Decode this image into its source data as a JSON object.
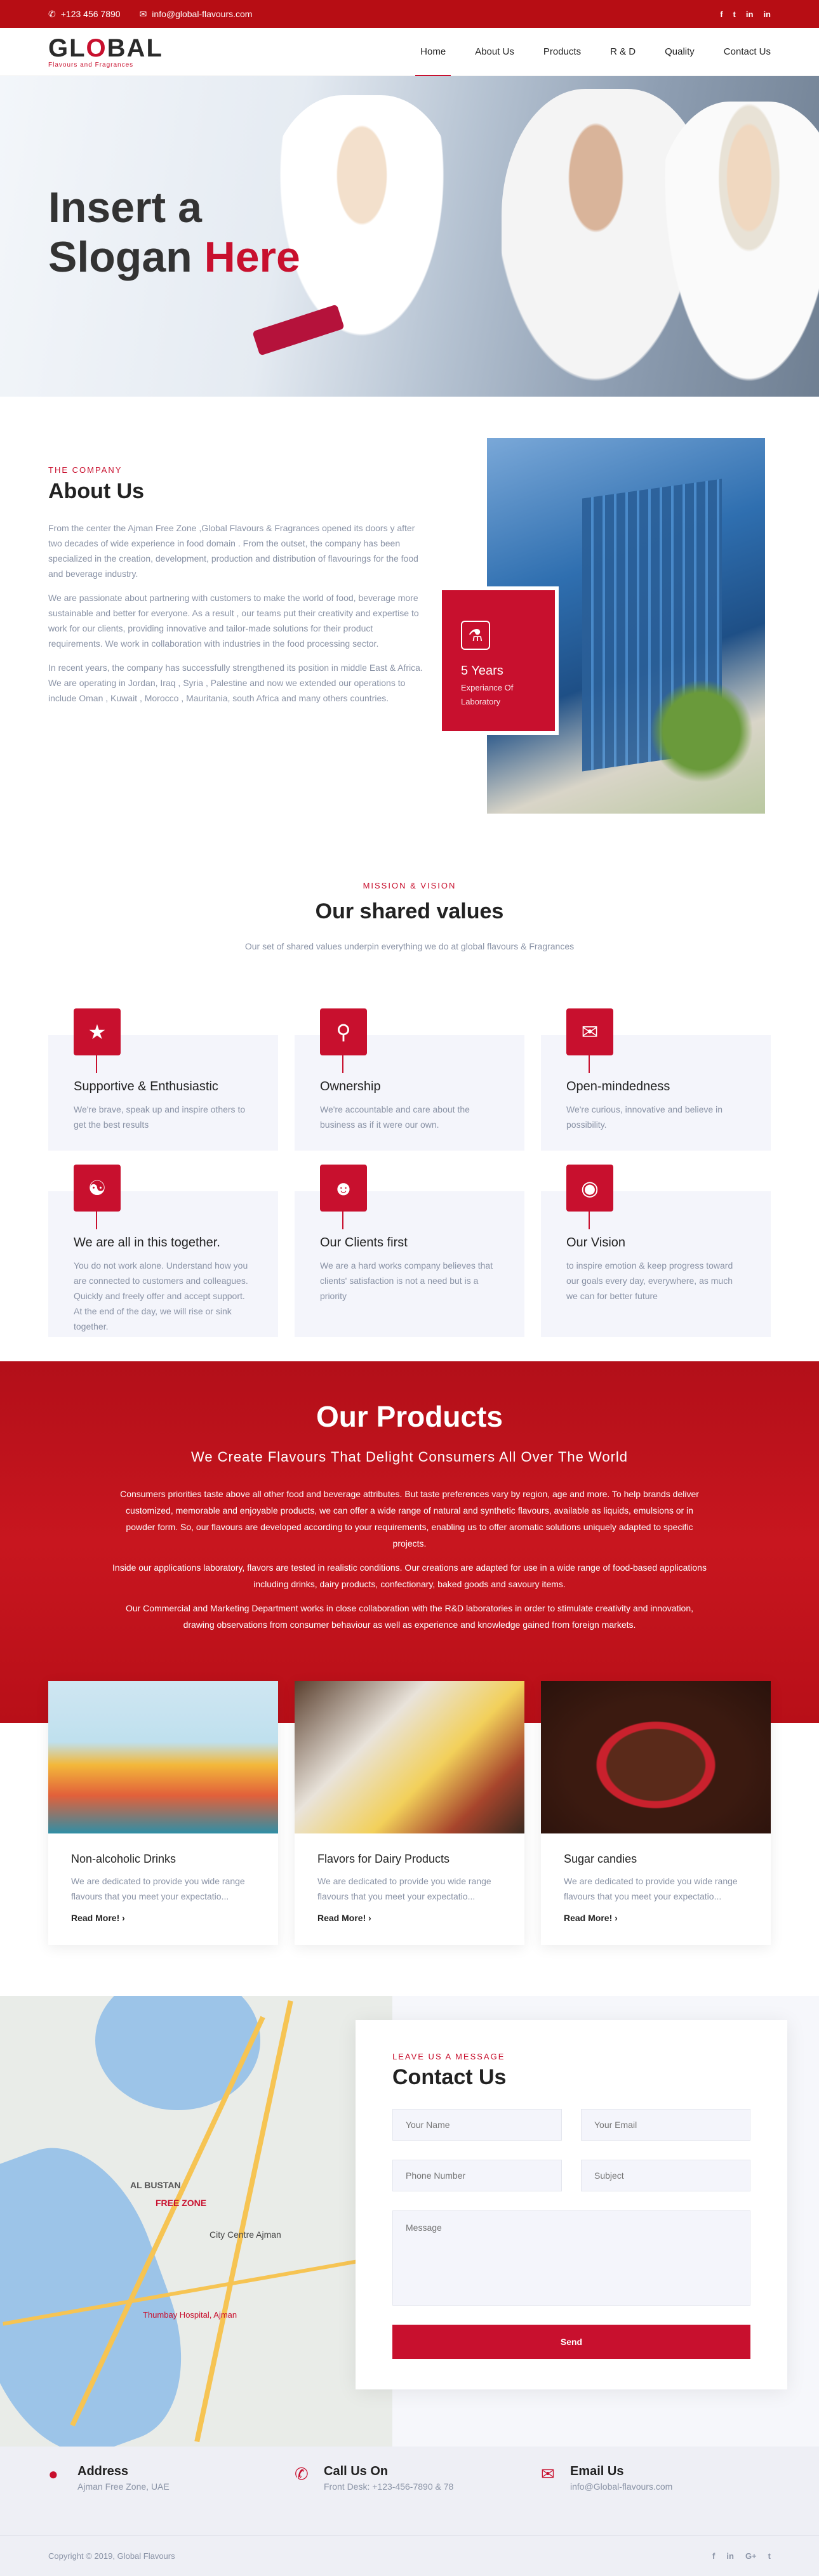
{
  "topbar": {
    "phone": "+123 456 7890",
    "email": "info@global-flavours.com",
    "social": [
      "f",
      "t",
      "in",
      "in"
    ]
  },
  "nav": {
    "logo_left": "GL",
    "logo_mid": "O",
    "logo_right": "BAL",
    "logo_tag": "Flavours and Fragrances",
    "items": [
      "Home",
      "About Us",
      "Products",
      "R & D",
      "Quality",
      "Contact Us"
    ]
  },
  "hero": {
    "line1": "Insert a",
    "line2a": "Slogan",
    "line2b": "Here"
  },
  "about": {
    "kicker": "THE COMPANY",
    "title": "About Us",
    "p1": "From the center the Ajman Free Zone ,Global Flavours & Fragrances opened its doors y after two decades of wide experience in food domain . From the outset, the company has been specialized in the creation, development, production and distribution of flavourings for the food and beverage industry.",
    "p2": "We are passionate about partnering with customers to make the world of food, beverage more sustainable and better for everyone. As a result , our teams put their creativity and expertise to work for our clients, providing innovative and tailor-made solutions for their product requirements. We work in collaboration with industries in the food processing sector.",
    "p3": "In recent years, the company has successfully strengthened its position in middle East & Africa. We are operating in Jordan, Iraq , Syria , Palestine and now we extended our operations to include Oman , Kuwait , Morocco , Mauritania, south Africa and many others countries.",
    "badge_years": "5 Years",
    "badge_sub": "Experiance Of Laboratory"
  },
  "values": {
    "kicker": "MISSION & VISION",
    "title": "Our shared values",
    "subtitle": "Our set of shared values underpin everything we do at global flavours & Fragrances",
    "cards": [
      {
        "title": "Supportive & Enthusiastic",
        "text": "We're brave, speak up and inspire others to get the best results"
      },
      {
        "title": "Ownership",
        "text": "We're accountable and care about the business as if it were our own."
      },
      {
        "title": "Open-mindedness",
        "text": "We're curious, innovative and believe in possibility."
      },
      {
        "title": "We are all in this together.",
        "text": "You do not work alone. Understand how you are connected to customers and colleagues. Quickly and freely offer and accept support. At the end of the day, we will rise or sink together."
      },
      {
        "title": "Our Clients first",
        "text": "We are a hard works company believes that clients' satisfaction is not a need but is a priority"
      },
      {
        "title": "Our Vision",
        "text": "to inspire emotion & keep progress toward our goals every day, everywhere, as much we can for better future"
      }
    ]
  },
  "products": {
    "title": "Our Products",
    "subtitle": "We Create Flavours That Delight Consumers All Over The World",
    "p1": "Consumers priorities taste above all other food and beverage attributes. But taste preferences vary by region, age and more. To help brands deliver customized, memorable and enjoyable products, we can offer a wide range of natural and synthetic flavours, available as liquids, emulsions or in powder form. So, our flavours are developed according to your requirements, enabling us to offer aromatic solutions uniquely adapted to specific projects.",
    "p2": "Inside our applications laboratory, flavors are tested in realistic conditions. Our creations are adapted for use in a wide range of food-based applications including drinks, dairy products, confectionary, baked goods and savoury items.",
    "p3": "Our Commercial and Marketing Department works in close collaboration with the R&D laboratories in order to stimulate creativity and innovation, drawing observations from consumer behaviour as well as experience and knowledge gained from foreign markets.",
    "cards": [
      {
        "title": "Non-alcoholic Drinks",
        "text": "We are dedicated to provide you wide range flavours that you meet your expectatio...",
        "more": "Read More!"
      },
      {
        "title": "Flavors for Dairy Products",
        "text": "We are dedicated to provide you wide range flavours that you meet your expectatio...",
        "more": "Read More!"
      },
      {
        "title": "Sugar candies",
        "text": "We are dedicated to provide you wide range flavours that you meet your expectatio...",
        "more": "Read More!"
      }
    ]
  },
  "map": {
    "label1": "AL BUSTAN",
    "label2": "FREE ZONE",
    "label3": "City Centre Ajman",
    "label4": "Thumbay Hospital, Ajman"
  },
  "contact": {
    "kicker": "LEAVE US A MESSAGE",
    "title": "Contact Us",
    "name_ph": "Your Name",
    "email_ph": "Your Email",
    "phone_ph": "Phone Number",
    "subject_ph": "Subject",
    "message_ph": "Message",
    "send": "Send"
  },
  "footer": {
    "address_title": "Address",
    "address_text": "Ajman Free Zone, UAE",
    "call_title": "Call Us On",
    "call_text": "Front Desk: +123-456-7890 & 78",
    "mail_title": "Email Us",
    "mail_text": "info@Global-flavours.com",
    "copyright": "Copyright © 2019, Global Flavours"
  }
}
